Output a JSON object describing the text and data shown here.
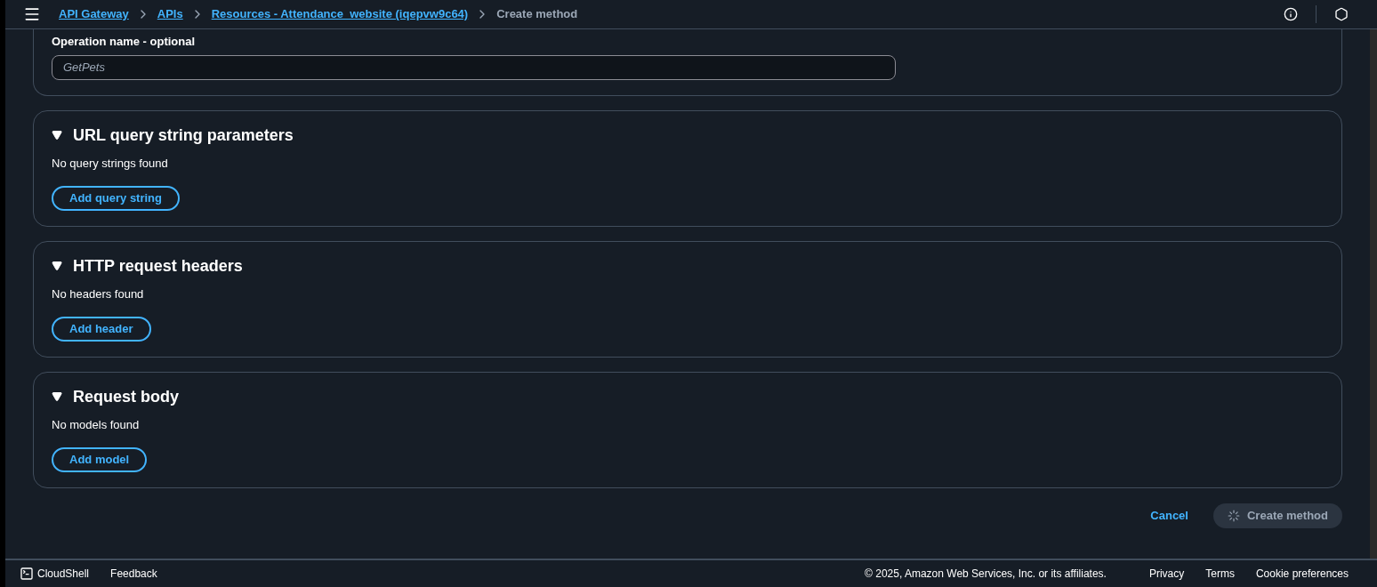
{
  "breadcrumbs": [
    {
      "label": "API Gateway",
      "link": true
    },
    {
      "label": "APIs",
      "link": true
    },
    {
      "label": "Resources - Attendance_website (iqepvw9c64)",
      "link": true
    },
    {
      "label": "Create method",
      "link": false
    }
  ],
  "operation_name": {
    "label": "Operation name - optional",
    "placeholder": "GetPets"
  },
  "sections": [
    {
      "title": "URL query string parameters",
      "expanded": true,
      "empty_text": "No query strings found",
      "button": "Add query string"
    },
    {
      "title": "HTTP request headers",
      "expanded": true,
      "empty_text": "No headers found",
      "button": "Add header"
    },
    {
      "title": "Request body",
      "expanded": true,
      "empty_text": "No models found",
      "button": "Add model"
    }
  ],
  "actions": {
    "cancel": "Cancel",
    "submit": {
      "label": "Create method",
      "loading": true
    }
  },
  "footer": {
    "cloudshell": "CloudShell",
    "feedback": "Feedback",
    "copyright": "© 2025, Amazon Web Services, Inc. or its affiliates.",
    "links": [
      "Privacy",
      "Terms",
      "Cookie preferences"
    ]
  }
}
